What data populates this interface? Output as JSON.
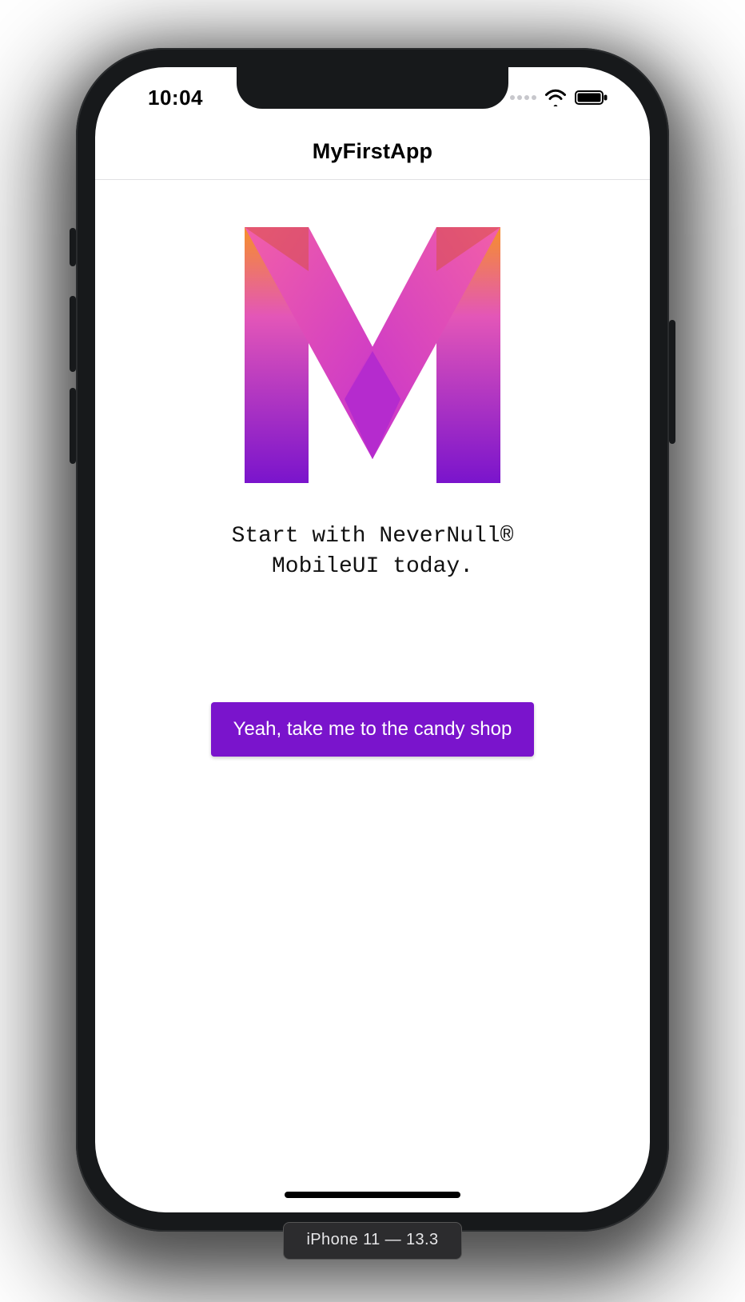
{
  "statusbar": {
    "time": "10:04"
  },
  "navbar": {
    "title": "MyFirstApp"
  },
  "main": {
    "tagline": "Start with NeverNull®\nMobileUI today.",
    "cta_label": "Yeah, take me to the candy shop"
  },
  "simulator": {
    "label": "iPhone 11 — 13.3"
  },
  "colors": {
    "accent": "#7a14cc"
  }
}
